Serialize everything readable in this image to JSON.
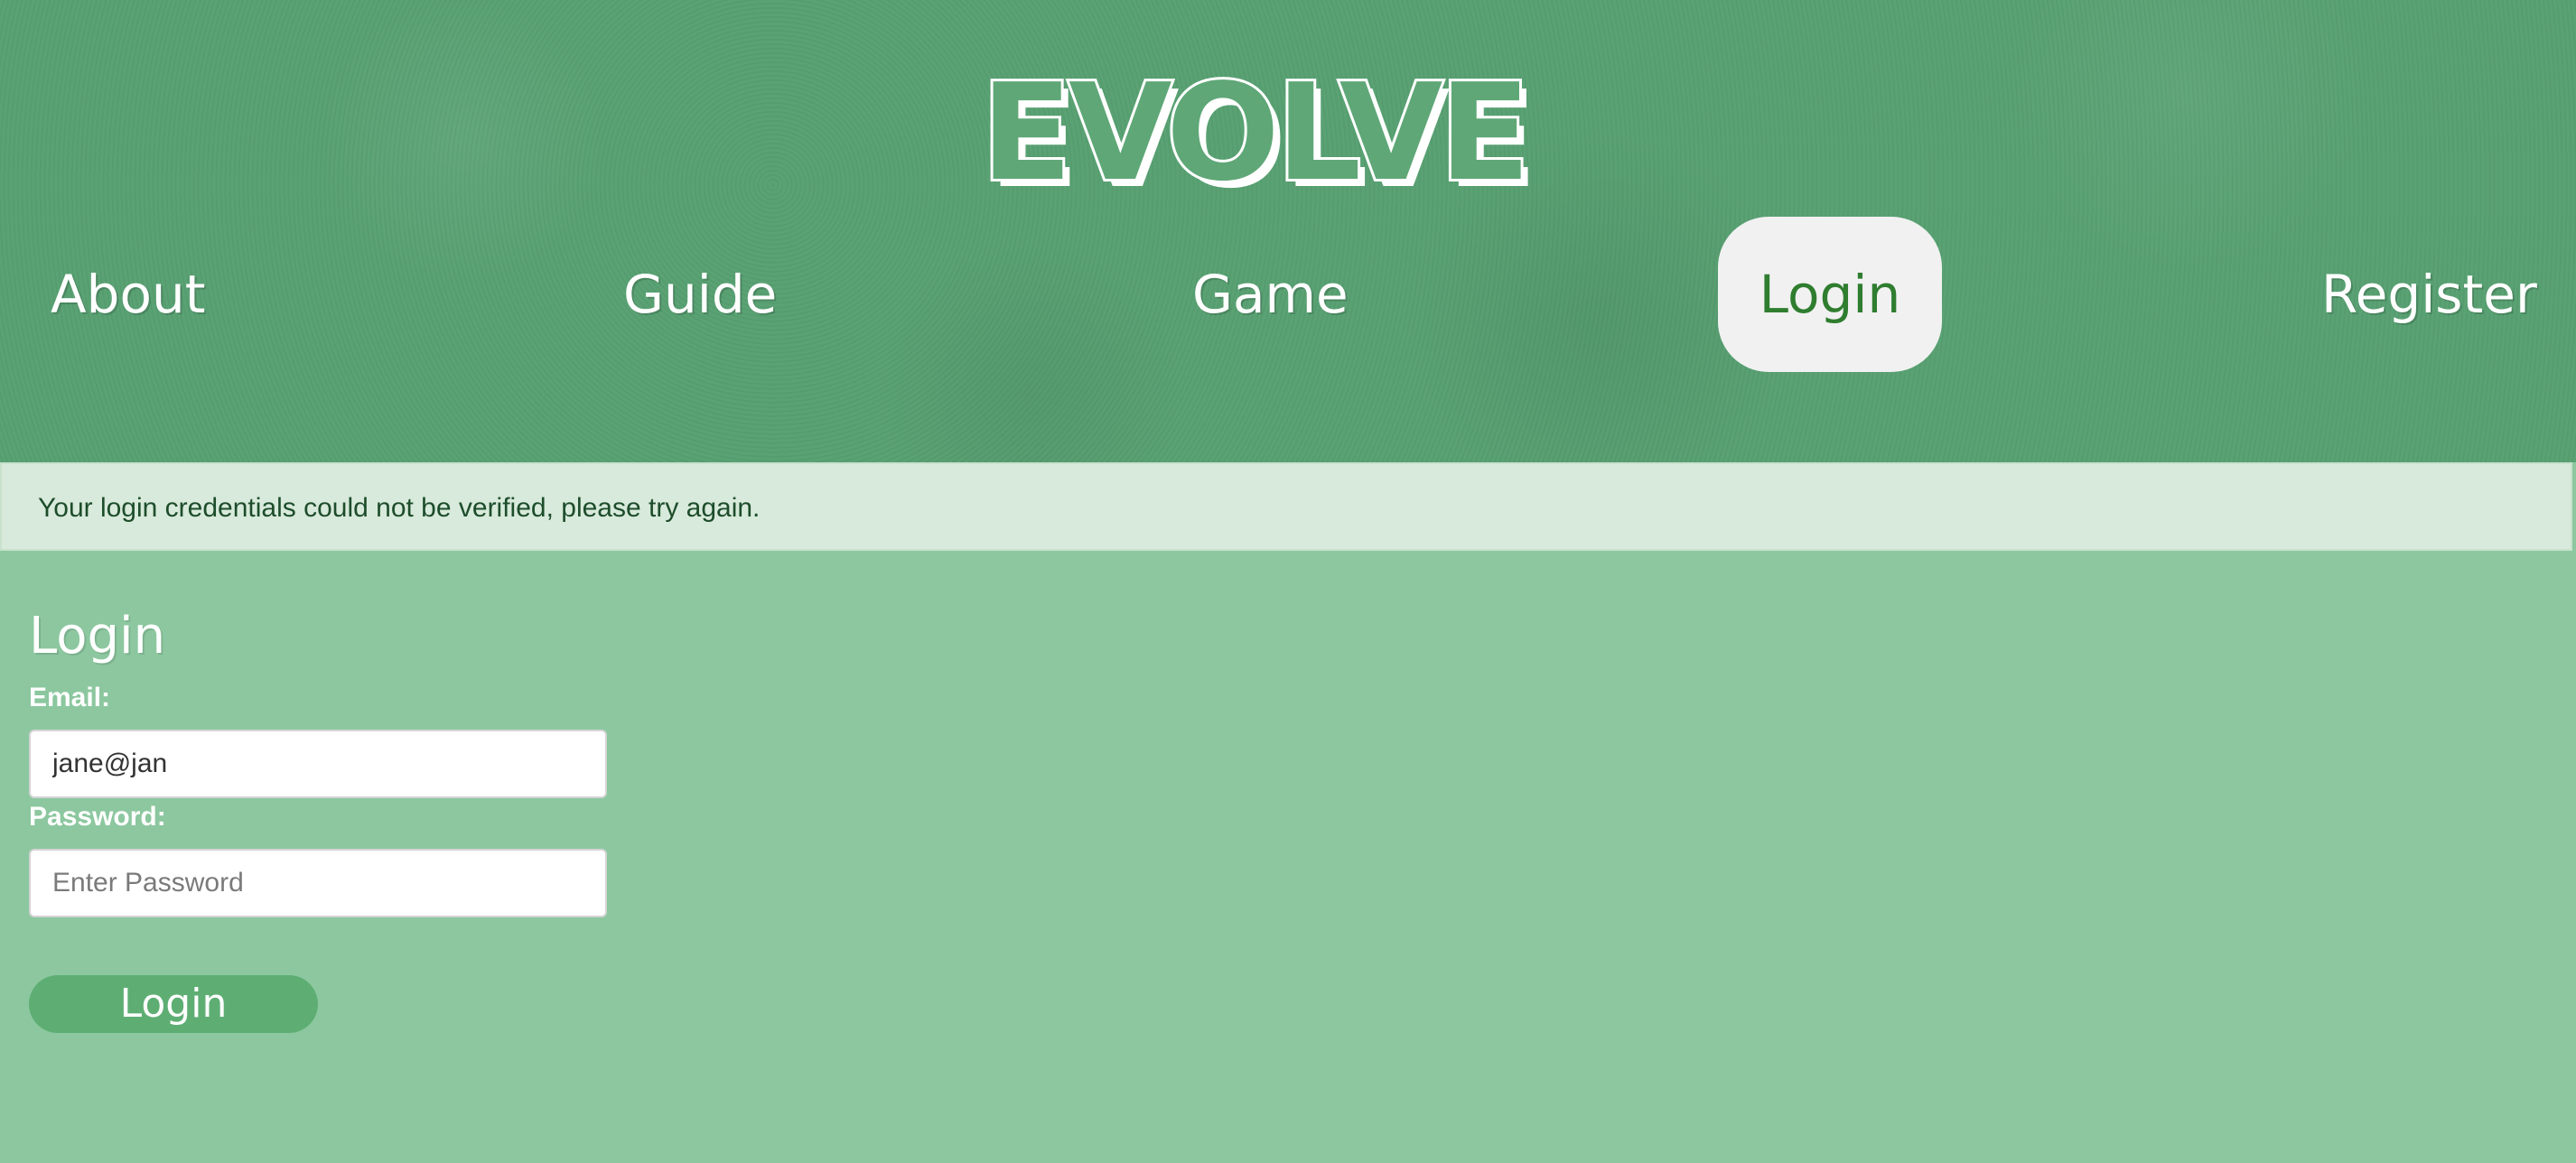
{
  "brand": {
    "logo_text": "EVOLVE"
  },
  "nav": {
    "items": [
      {
        "label": "About"
      },
      {
        "label": "Guide"
      },
      {
        "label": "Game"
      },
      {
        "label": "Login",
        "active": true
      },
      {
        "label": "Register"
      }
    ]
  },
  "alert": {
    "message": "Your login credentials could not be verified, please try again."
  },
  "login_form": {
    "title": "Login",
    "email_label": "Email:",
    "email_value": "jane@jan",
    "password_label": "Password:",
    "password_placeholder": "Enter Password",
    "submit_label": "Login"
  },
  "colors": {
    "header_bg": "#57a071",
    "page_bg": "#8cc79f",
    "alert_bg": "#d8eadb",
    "alert_text": "#1d4d2b",
    "active_nav_bg": "#f1f1f1",
    "active_nav_text": "#2f7d2f",
    "button_bg": "#5eae74"
  }
}
